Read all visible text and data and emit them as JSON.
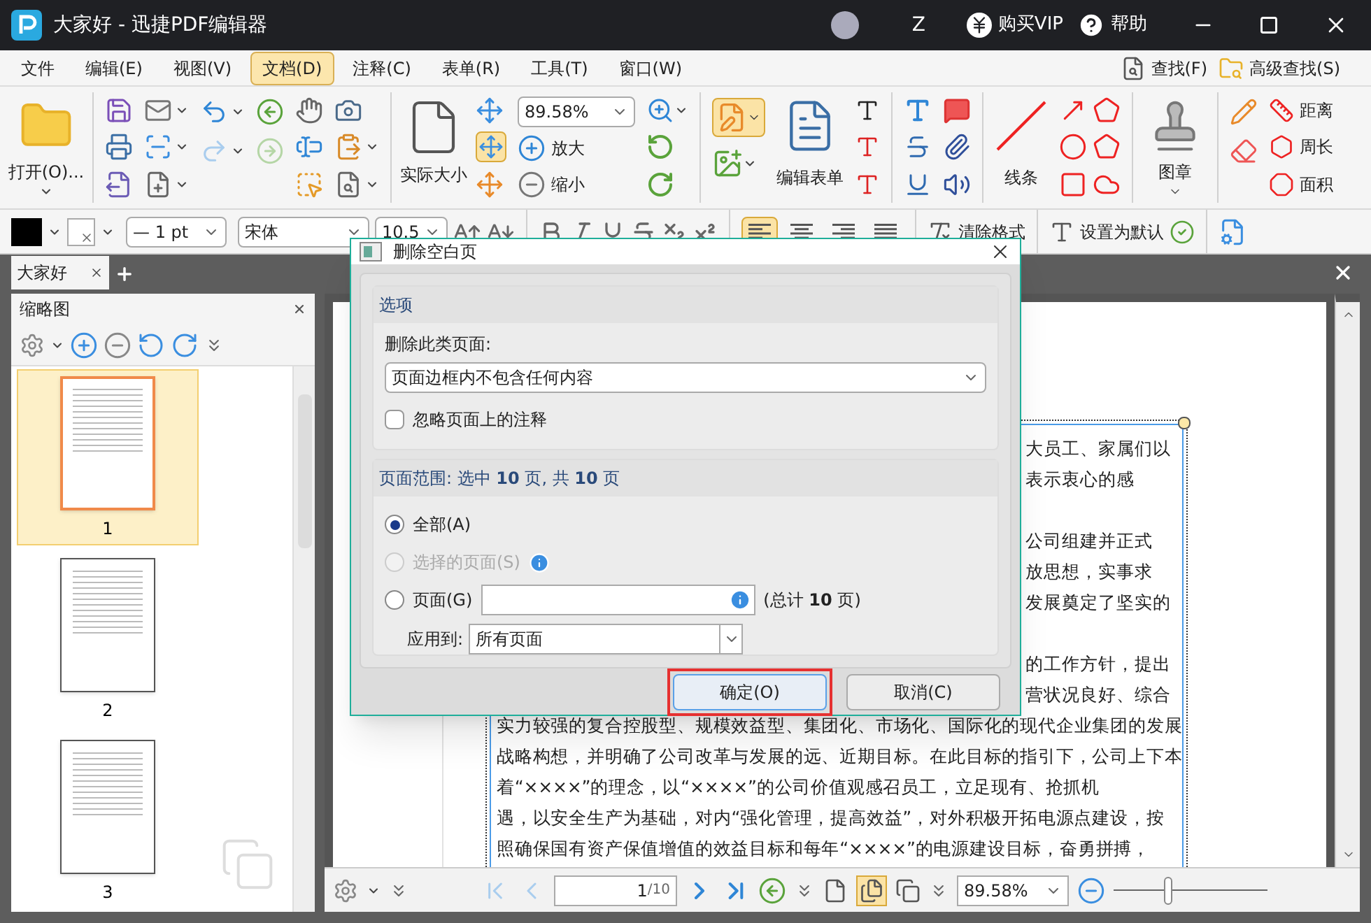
{
  "window": {
    "title": "大家好 - 迅捷PDF编辑器",
    "user": "Z",
    "buy_vip": "购买VIP",
    "help": "帮助"
  },
  "menu": [
    {
      "label": "文件",
      "selected": false
    },
    {
      "label": "编辑(E)",
      "selected": false
    },
    {
      "label": "视图(V)",
      "selected": false
    },
    {
      "label": "文档(D)",
      "selected": true
    },
    {
      "label": "注释(C)",
      "selected": false
    },
    {
      "label": "表单(R)",
      "selected": false
    },
    {
      "label": "工具(T)",
      "selected": false
    },
    {
      "label": "窗口(W)",
      "selected": false
    }
  ],
  "search": {
    "find": "查找(F)",
    "advanced": "高级查找(S)"
  },
  "ribbon": {
    "open": "打开(O)...",
    "actual_size": "实际大小",
    "zoom": "89.58%",
    "zoom_in": "放大",
    "zoom_out": "缩小",
    "edit_form": "编辑表单",
    "lines": "线条",
    "stamp": "图章",
    "distance": "距离",
    "perimeter": "周长",
    "area": "面积"
  },
  "format_bar": {
    "line_width": "— 1 pt",
    "font": "宋体",
    "font_size": "10.5",
    "alignment": [
      {
        "kind": "left",
        "selected": true
      },
      {
        "kind": "center",
        "selected": false
      },
      {
        "kind": "right",
        "selected": false
      },
      {
        "kind": "justify",
        "selected": false
      }
    ],
    "clear_format": "清除格式",
    "set_default": "设置为默认"
  },
  "tabs": [
    {
      "label": "大家好",
      "selected": true
    }
  ],
  "thumbnails": {
    "title": "缩略图",
    "pages": [
      {
        "label": "1",
        "selected": true
      },
      {
        "label": "2",
        "selected": false
      },
      {
        "label": "3",
        "selected": false
      }
    ]
  },
  "document": {
    "lines": [
      {
        "kind": "partial",
        "text": "大员工、家属们以"
      },
      {
        "kind": "partial",
        "text": "表示衷心的感"
      },
      {
        "kind": "blank"
      },
      {
        "kind": "partial",
        "text": "公司组建并正式"
      },
      {
        "kind": "partial",
        "text": "放思想，实事求"
      },
      {
        "kind": "partial",
        "text": "发展奠定了坚实的"
      },
      {
        "kind": "blank"
      },
      {
        "kind": "partial",
        "text": "的工作方针，提出"
      },
      {
        "kind": "partial",
        "text": "营状况良好、综合"
      },
      {
        "kind": "full",
        "text": "实力较强的复合控股型、规模效益型、集团化、市场化、国际化的现代企业集团的发展"
      },
      {
        "kind": "full",
        "text": "战略构想，并明确了公司改革与发展的远、近期目标。在此目标的指引下，公司上下本"
      },
      {
        "kind": "full",
        "text": "着“××××”的理念，以“××××”的公司价值观感召员工，立足现有、抢抓机"
      },
      {
        "kind": "full",
        "text": "遇，以安全生产为基础，对内“强化管理，提高效益”，对外积极开拓电源点建设，按"
      },
      {
        "kind": "full",
        "text": "照确保国有资产保值增值的效益目标和每年“××××”的电源建设目标，奋勇拼搏，"
      }
    ]
  },
  "nav": {
    "page": "1",
    "total": "/10",
    "zoom": "89.58%",
    "zoom_slider": {
      "level": 0.35
    }
  },
  "dialog": {
    "title": "删除空白页",
    "options_header": "选项",
    "type_label": "删除此类页面:",
    "type_value": "页面边框内不包含任何内容",
    "ignore_annotations": {
      "label": "忽略页面上的注释",
      "checked": false
    },
    "range_header": "页面范围: 选中 **10** 页, 共 **10** 页",
    "ranges": [
      {
        "kind": "plain",
        "label": "全部(A)",
        "selected": true,
        "disabled": false
      },
      {
        "kind": "info",
        "label": "选择的页面(S)",
        "selected": false,
        "disabled": true
      },
      {
        "kind": "field",
        "label": "页面(G)",
        "selected": false,
        "disabled": false
      }
    ],
    "page_total": "(总计 **10** 页)",
    "apply_label": "应用到:",
    "apply_value": "所有页面",
    "buttons": [
      {
        "label": "确定(O)",
        "selected": true,
        "highlighted": true
      },
      {
        "label": "取消(C)",
        "selected": false,
        "highlighted": false
      }
    ]
  }
}
